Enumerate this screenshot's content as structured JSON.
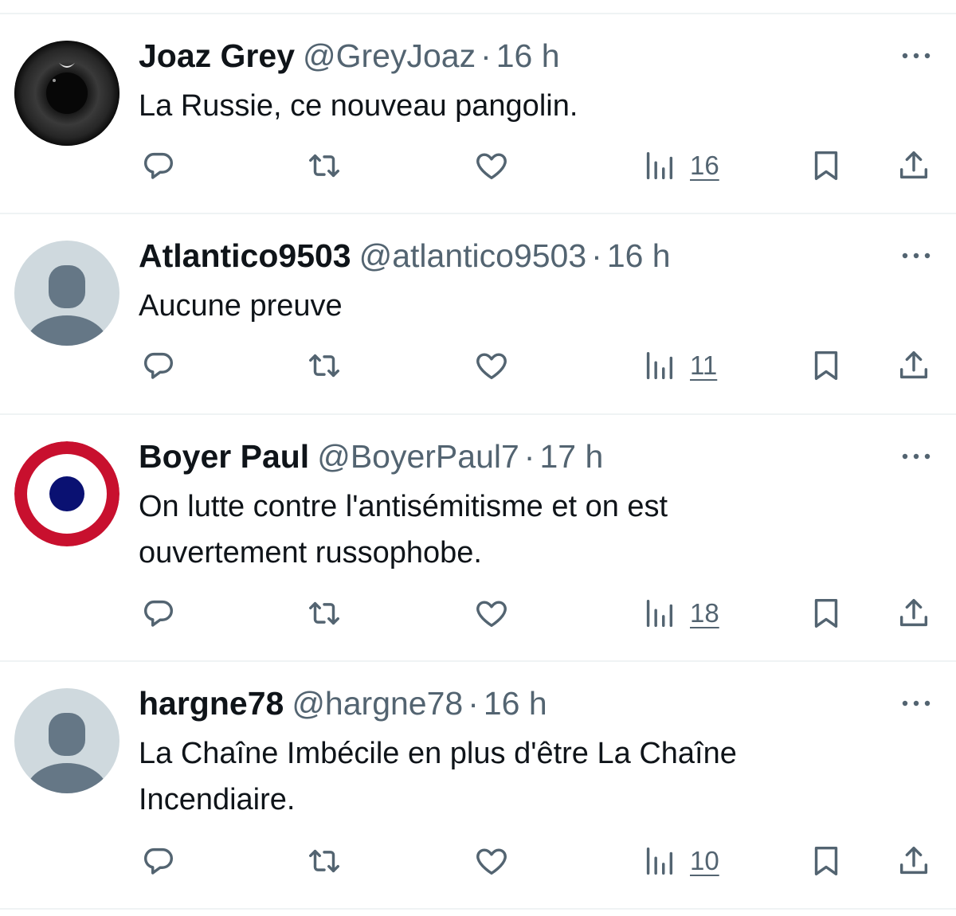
{
  "colors": {
    "text_primary": "#0f1419",
    "text_secondary": "#536471",
    "divider": "#eff3f4"
  },
  "tweets": [
    {
      "name": "Joaz Grey",
      "handle": "@GreyJoaz",
      "separator": "·",
      "time": "16 h",
      "text": "La Russie, ce nouveau pangolin.",
      "views": "16",
      "avatar": "dark-eye-eclipse-avatar"
    },
    {
      "name": "Atlantico9503",
      "handle": "@atlantico9503",
      "separator": "·",
      "time": "16 h",
      "text": "Aucune preuve",
      "views": "11",
      "avatar": "default-user-avatar"
    },
    {
      "name": "Boyer Paul",
      "handle": "@BoyerPaul7",
      "separator": "·",
      "time": "17 h",
      "text": "On lutte contre l'antisémitisme et on est ouvertement russophobe.",
      "views": "18",
      "avatar": "french-roundel-avatar"
    },
    {
      "name": "hargne78",
      "handle": "@hargne78",
      "separator": "·",
      "time": "16 h",
      "text": "La Chaîne Imbécile en plus d'être La Chaîne Incendiaire.",
      "views": "10",
      "avatar": "default-user-avatar"
    }
  ],
  "icons": {
    "reply": "reply-bubble-icon",
    "retweet": "retweet-icon",
    "like": "heart-icon",
    "views": "views-bar-chart-icon",
    "bookmark": "bookmark-icon",
    "share": "share-upload-icon",
    "more": "more-dots-icon"
  }
}
